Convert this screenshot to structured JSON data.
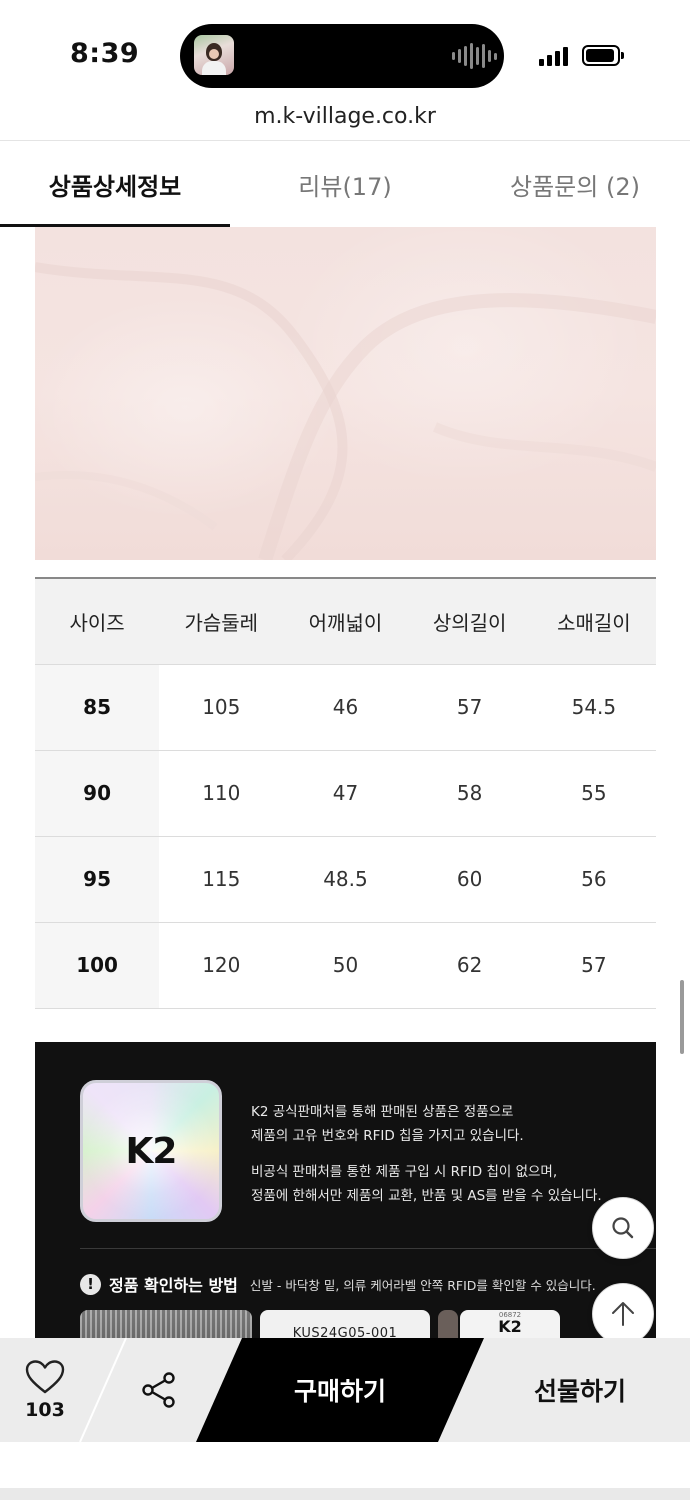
{
  "status_bar": {
    "time": "8:39",
    "url": "m.k-village.co.kr"
  },
  "tabs": [
    {
      "label": "상품상세정보",
      "active": true
    },
    {
      "label": "리뷰(17)",
      "active": false
    },
    {
      "label": "상품문의 (2)",
      "active": false
    }
  ],
  "size_table": {
    "headers": [
      "사이즈",
      "가슴둘레",
      "어깨넓이",
      "상의길이",
      "소매길이"
    ],
    "rows": [
      [
        "85",
        "105",
        "46",
        "57",
        "54.5"
      ],
      [
        "90",
        "110",
        "47",
        "58",
        "55"
      ],
      [
        "95",
        "115",
        "48.5",
        "60",
        "56"
      ],
      [
        "100",
        "120",
        "50",
        "62",
        "57"
      ]
    ]
  },
  "auth_banner": {
    "logo_text": "K2",
    "paragraph1_line1": "K2 공식판매처를 통해 판매된 상품은 정품으로",
    "paragraph1_line2": "제품의 고유 번호와 RFID 칩을 가지고 있습니다.",
    "paragraph2_line1": "비공식 판매처를 통한 제품 구입 시 RFID 칩이 없으며,",
    "paragraph2_line2": "정품에 한해서만 제품의 교환, 반품 및 AS를 받을 수 있습니다.",
    "check_icon_text": "!",
    "check_title": "정품 확인하는 방법",
    "check_desc": "신발 - 바닥창 밑, 의류 케어라벨 안쪽 RFID를 확인할 수 있습니다.",
    "sample_code": "KUS24G05-001",
    "tag_small": "06872",
    "tag_brand": "K2"
  },
  "bottom_bar": {
    "like_count": "103",
    "buy_label": "구매하기",
    "gift_label": "선물하기"
  },
  "colors": {
    "accent": "#111111",
    "photo_tint": "#f4e3e0",
    "table_header_bg": "#f2f2f2",
    "banner_bg": "#111111"
  },
  "icons": [
    "heart-icon",
    "share-icon",
    "search-icon",
    "arrow-up-icon",
    "alert-icon"
  ]
}
